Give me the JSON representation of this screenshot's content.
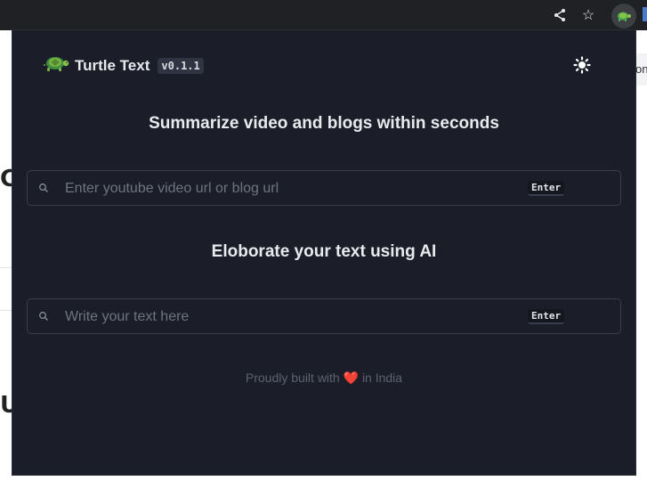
{
  "browser": {
    "share_icon": "share-icon",
    "bookmark_icon": "star-icon",
    "extension_icon": "turtle-icon"
  },
  "background_page": {
    "letter_1": "C",
    "letter_2": "U",
    "right_partial": "on"
  },
  "popup": {
    "brand": {
      "name": "Turtle Text",
      "version": "v0.1.1",
      "logo_icon": "turtle-icon"
    },
    "theme_toggle_icon": "sun-icon",
    "summarize": {
      "heading": "Summarize video and blogs within seconds",
      "placeholder": "Enter youtube video url or blog url",
      "value": "",
      "key_hint": "Enter"
    },
    "elaborate": {
      "heading": "Eloborate your text using AI",
      "placeholder": "Write your text here",
      "value": "",
      "key_hint": "Enter"
    },
    "footer": {
      "before": "Proudly built with",
      "heart": "❤️",
      "after": "in India"
    }
  },
  "colors": {
    "popup_bg": "#1b1e29",
    "text": "#e9eaee",
    "muted": "#5d6170",
    "border": "#3a3e4c",
    "heart": "#e0245e"
  }
}
